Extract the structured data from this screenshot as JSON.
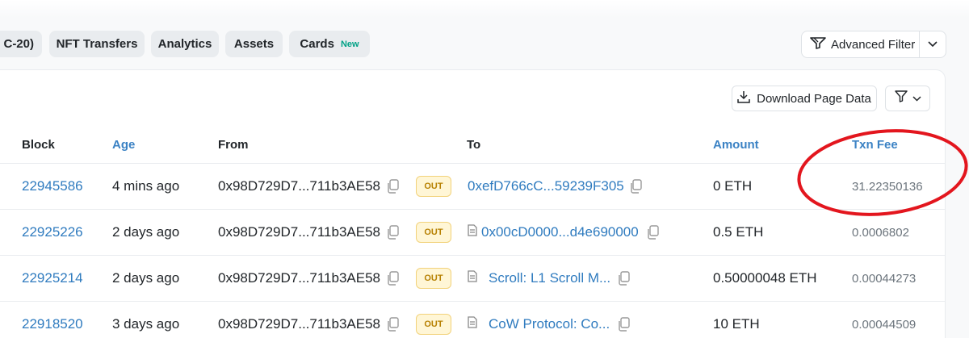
{
  "tabs": [
    {
      "label": "C-20)"
    },
    {
      "label": "NFT Transfers"
    },
    {
      "label": "Analytics"
    },
    {
      "label": "Assets"
    },
    {
      "label": "Cards",
      "badge": "New"
    }
  ],
  "advanced_filter": {
    "label": "Advanced Filter"
  },
  "download": {
    "label": "Download Page Data"
  },
  "table": {
    "headers": {
      "block": "Block",
      "age": "Age",
      "from": "From",
      "to": "To",
      "amount": "Amount",
      "txn_fee": "Txn Fee"
    },
    "rows": [
      {
        "block": "22945586",
        "age": "4 mins ago",
        "from": "0x98D729D7...711b3AE58",
        "direction": "OUT",
        "to": "0xefD766cC...59239F305",
        "to_is_contract": false,
        "amount": "0 ETH",
        "fee": "31.22350136"
      },
      {
        "block": "22925226",
        "age": "2 days ago",
        "from": "0x98D729D7...711b3AE58",
        "direction": "OUT",
        "to": "0x00cD0000...d4e690000",
        "to_is_contract": true,
        "amount": "0.5 ETH",
        "fee": "0.0006802"
      },
      {
        "block": "22925214",
        "age": "2 days ago",
        "from": "0x98D729D7...711b3AE58",
        "direction": "OUT",
        "to": "Scroll: L1 Scroll M...",
        "to_is_contract": true,
        "amount": "0.50000048 ETH",
        "fee": "0.00044273"
      },
      {
        "block": "22918520",
        "age": "3 days ago",
        "from": "0x98D729D7...711b3AE58",
        "direction": "OUT",
        "to": "CoW Protocol: Co...",
        "to_is_contract": true,
        "amount": "10 ETH",
        "fee": "0.00044509"
      }
    ]
  },
  "colors": {
    "link": "#2f7bbf",
    "annotation": "#e3161e",
    "out_badge": "#fff6d6",
    "new_badge": "#00a186"
  }
}
